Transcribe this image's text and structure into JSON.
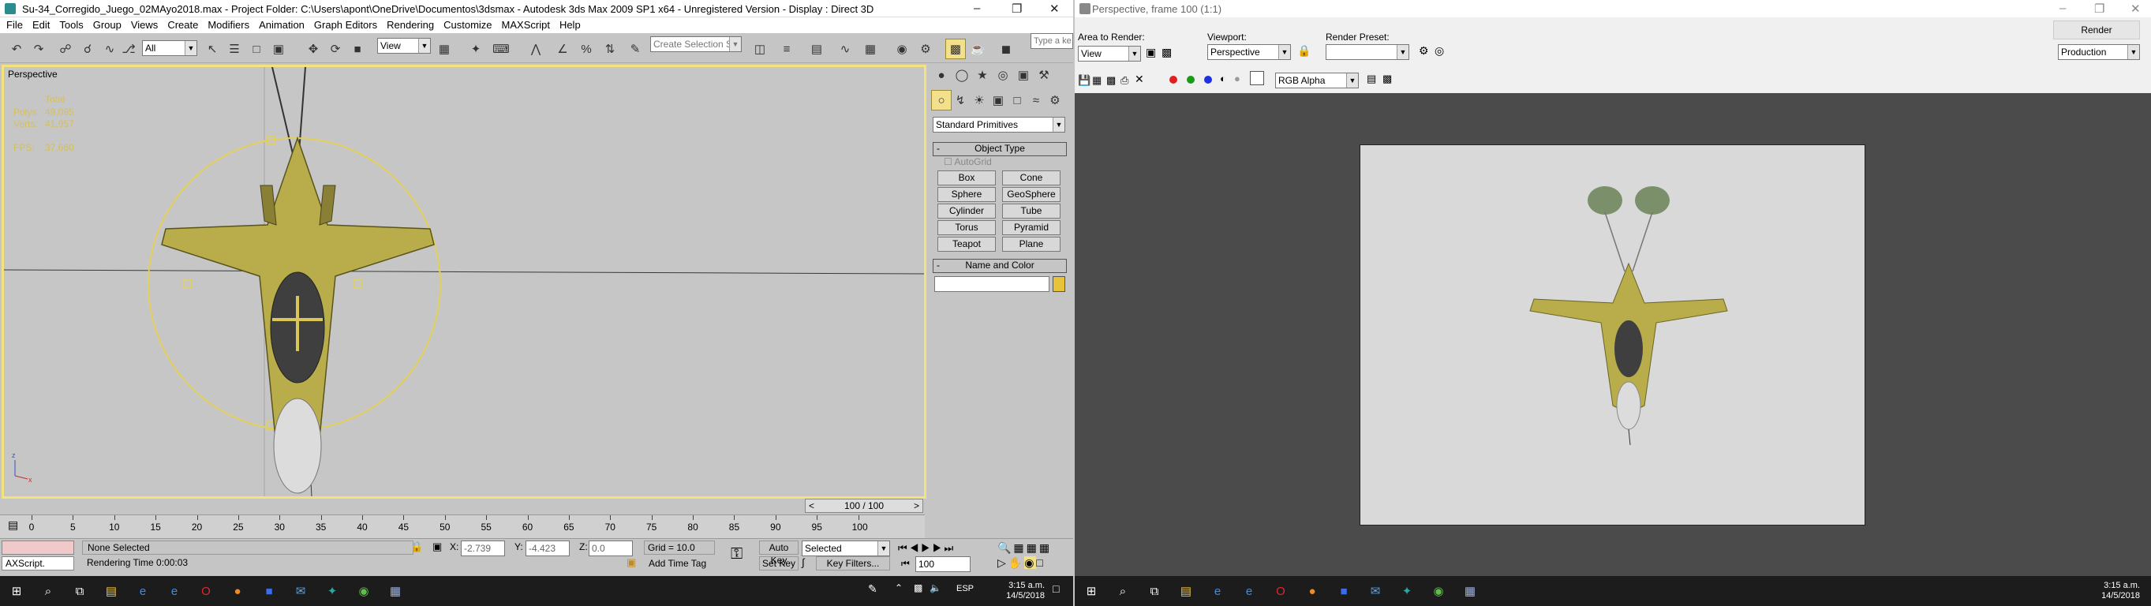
{
  "left_window": {
    "title": "Su-34_Corregido_Juego_02MAyo2018.max   - Project Folder: C:\\Users\\apont\\OneDrive\\Documentos\\3dsmax   - Autodesk 3ds Max  2009 SP1  x64   - Unregistered Version   - Display : Direct 3D",
    "menu": [
      "File",
      "Edit",
      "Tools",
      "Group",
      "Views",
      "Create",
      "Modifiers",
      "Animation",
      "Graph Editors",
      "Rendering",
      "Customize",
      "MAXScript",
      "Help"
    ],
    "toolbar": {
      "selection_filter": "All",
      "ref_coord": "View",
      "named_selection_placeholder": "Create Selection Se",
      "search_placeholder": "Type a ke"
    },
    "viewport": {
      "label": "Perspective",
      "stats_header": "Total",
      "polys_label": "Polys:",
      "polys_value": "49,085",
      "verts_label": "Verts:",
      "verts_value": "41,957",
      "fps_label": "FPS:",
      "fps_value": "37.660"
    },
    "command_panel": {
      "category": "Standard Primitives",
      "object_type_title": "Object Type",
      "autogrid": "AutoGrid",
      "buttons": [
        "Box",
        "Cone",
        "Sphere",
        "GeoSphere",
        "Cylinder",
        "Tube",
        "Torus",
        "Pyramid",
        "Teapot",
        "Plane"
      ],
      "name_color_title": "Name and Color",
      "name_value": "",
      "object_color": "#e8c33a"
    },
    "timeline": {
      "frame_counter": "100 / 100",
      "ticks": [
        "0",
        "5",
        "10",
        "15",
        "20",
        "25",
        "30",
        "35",
        "40",
        "45",
        "50",
        "55",
        "60",
        "65",
        "70",
        "75",
        "80",
        "85",
        "90",
        "95",
        "100"
      ]
    },
    "status": {
      "maxscript": "AXScript.",
      "selection": "None Selected",
      "rendering_time": "Rendering Time  0:00:03",
      "x_label": "X:",
      "x_value": "-2.739",
      "y_label": "Y:",
      "y_value": "-4.423",
      "z_label": "Z:",
      "z_value": "0.0",
      "grid": "Grid = 10.0",
      "add_time_tag": "Add Time Tag",
      "auto_key": "Auto Key",
      "set_key": "Set Key",
      "key_mode": "Selected",
      "key_filters": "Key Filters...",
      "frame_field": "100"
    }
  },
  "right_window": {
    "title": "Perspective, frame 100 (1:1)",
    "area_to_render_label": "Area to Render:",
    "area_to_render_value": "View",
    "viewport_label": "Viewport:",
    "viewport_value": "Perspective",
    "render_preset_label": "Render Preset:",
    "render_preset_value": "",
    "render_button": "Render",
    "production_value": "Production",
    "channel_value": "RGB Alpha",
    "channel_colors": [
      "#e02020",
      "#1a9a1a",
      "#2030e0"
    ]
  },
  "taskbar_left": {
    "icons": [
      "windows-start-icon",
      "search-icon",
      "task-view-icon",
      "file-explorer-icon",
      "edge-icon",
      "ie-icon",
      "opera-icon",
      "firefox-icon",
      "app-icon",
      "mail-icon",
      "3dsmax-icon",
      "chrome-icon",
      "app2-icon"
    ],
    "language": "ESP",
    "time": "3:15 a.m.",
    "date": "14/5/2018"
  },
  "taskbar_right": {
    "time": "3:15 a.m.",
    "date": "14/5/2018"
  }
}
